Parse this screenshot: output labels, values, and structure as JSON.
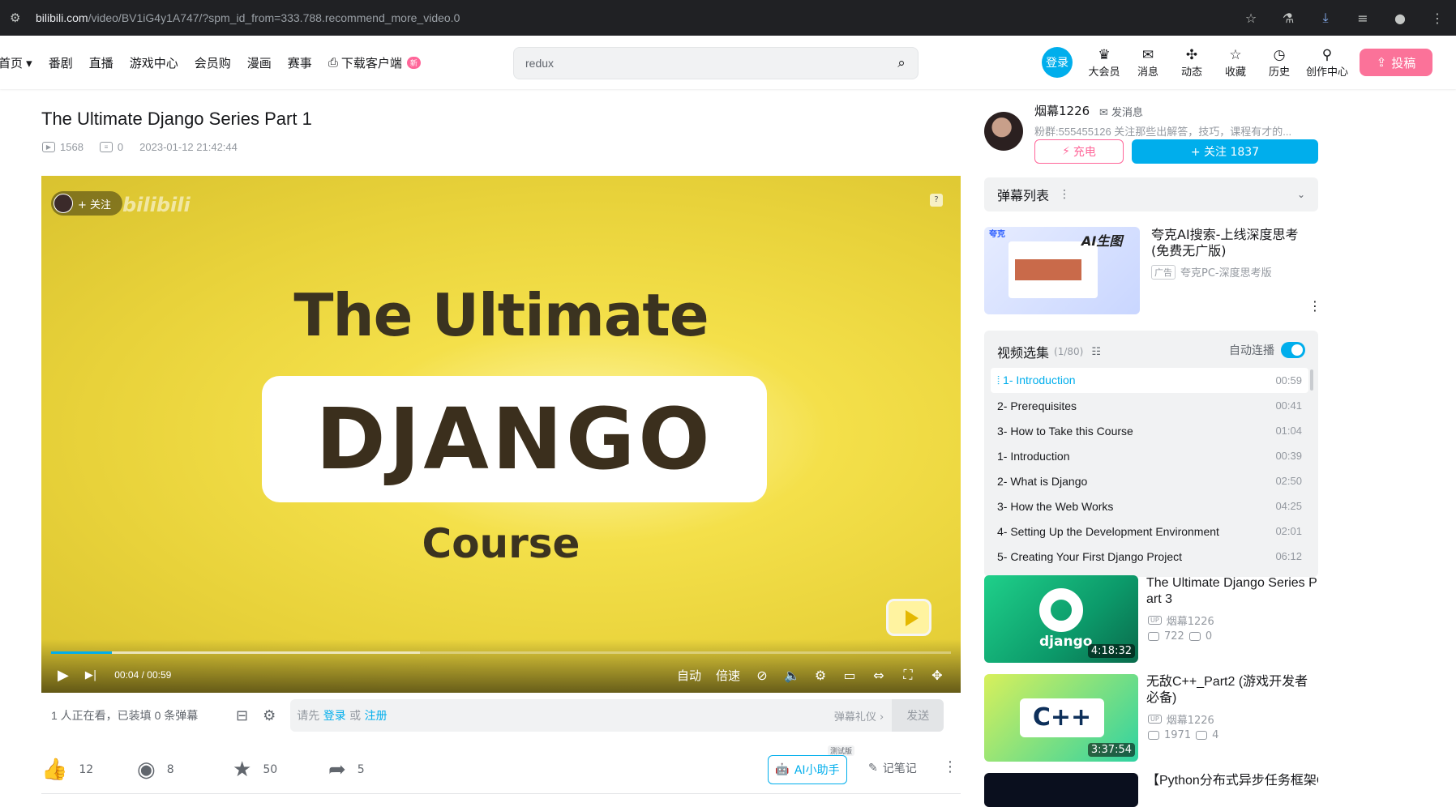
{
  "browser": {
    "url_host": "bilibili.com",
    "url_path": "/video/BV1iG4y1A747/?spm_id_from=333.788.recommend_more_video.0",
    "icons": [
      "star-icon",
      "lab-icon",
      "download-icon",
      "tab-search-icon",
      "profile-icon",
      "menu-icon"
    ]
  },
  "header": {
    "nav": [
      "首页",
      "番剧",
      "直播",
      "游戏中心",
      "会员购",
      "漫画",
      "赛事",
      "下载客户端"
    ],
    "new_badge": "新",
    "search_placeholder": "redux",
    "login_label": "登录",
    "right_items": [
      {
        "label": "大会员",
        "icon": "vip-icon"
      },
      {
        "label": "消息",
        "icon": "message-icon"
      },
      {
        "label": "动态",
        "icon": "activity-icon"
      },
      {
        "label": "收藏",
        "icon": "favorite-icon"
      },
      {
        "label": "历史",
        "icon": "history-icon"
      },
      {
        "label": "创作中心",
        "icon": "creator-icon"
      }
    ],
    "upload_label": "投稿"
  },
  "video": {
    "title": "The Ultimate Django Series Part 1",
    "views": "1568",
    "danmaku_count": "0",
    "date": "2023-01-12 21:42:44",
    "frame_line1": "The Ultimate",
    "frame_line2": "DJANGO",
    "frame_line3": "Course",
    "watermark": "烟幕1226 bilibili",
    "follow_pill": "+ 关注",
    "progress": 0.068,
    "buffered": 0.41,
    "time_current": "00:04",
    "time_sep": "/",
    "time_total": "00:59",
    "auto_label": "自动",
    "speed_label": "倍速"
  },
  "danmaku_bar": {
    "info": "1 人正在看，已装填 0 条弹幕",
    "placeholder_prefix": "请先",
    "login": "登录",
    "or": "或",
    "register": "注册",
    "etiquette": "弹幕礼仪 ›",
    "send": "发送"
  },
  "actions": {
    "like": "12",
    "coin": "8",
    "favorite": "50",
    "share": "5",
    "ai_label": "AI小助手",
    "beta": "测试版",
    "notes": "记笔记"
  },
  "uploader": {
    "name": "烟幕1226",
    "message": "发消息",
    "desc": "粉群:555455126 关注那些出解答，技巧，课程有才的...",
    "charge": "充电",
    "follow": "+ 关注 1837"
  },
  "danmaku_list": {
    "label": "弹幕列表"
  },
  "ad": {
    "title": "夸克AI搜索-上线深度思考(免费无广版)",
    "badge": "广告",
    "source": "夸克PC-深度思考版",
    "brand": "夸克",
    "tagline": "AI生图"
  },
  "playlist": {
    "label": "视频选集",
    "count": "(1/80)",
    "autoplay": "自动连播",
    "items": [
      {
        "title": "1- Introduction",
        "dur": "00:59",
        "active": true
      },
      {
        "title": "2- Prerequisites",
        "dur": "00:41"
      },
      {
        "title": "3- How to Take this Course",
        "dur": "01:04"
      },
      {
        "title": "1- Introduction",
        "dur": "00:39"
      },
      {
        "title": "2- What is Django",
        "dur": "02:50"
      },
      {
        "title": "3- How the Web Works",
        "dur": "04:25"
      },
      {
        "title": "4- Setting Up the Development Environment",
        "dur": "02:01"
      },
      {
        "title": "5- Creating Your First Django Project",
        "dur": "06:12"
      }
    ]
  },
  "recommendations": [
    {
      "title": "The Ultimate Django Series Part 3",
      "owner": "烟幕1226",
      "views": "722",
      "danmaku": "0",
      "duration": "4:18:32",
      "thumb_text": "django"
    },
    {
      "title": "无敌C++_Part2 (游戏开发者必备)",
      "owner": "烟幕1226",
      "views": "1971",
      "danmaku": "4",
      "duration": "3:37:54",
      "thumb_text": "C++"
    },
    {
      "title": "【Python分布式异步任务框架C"
    }
  ]
}
